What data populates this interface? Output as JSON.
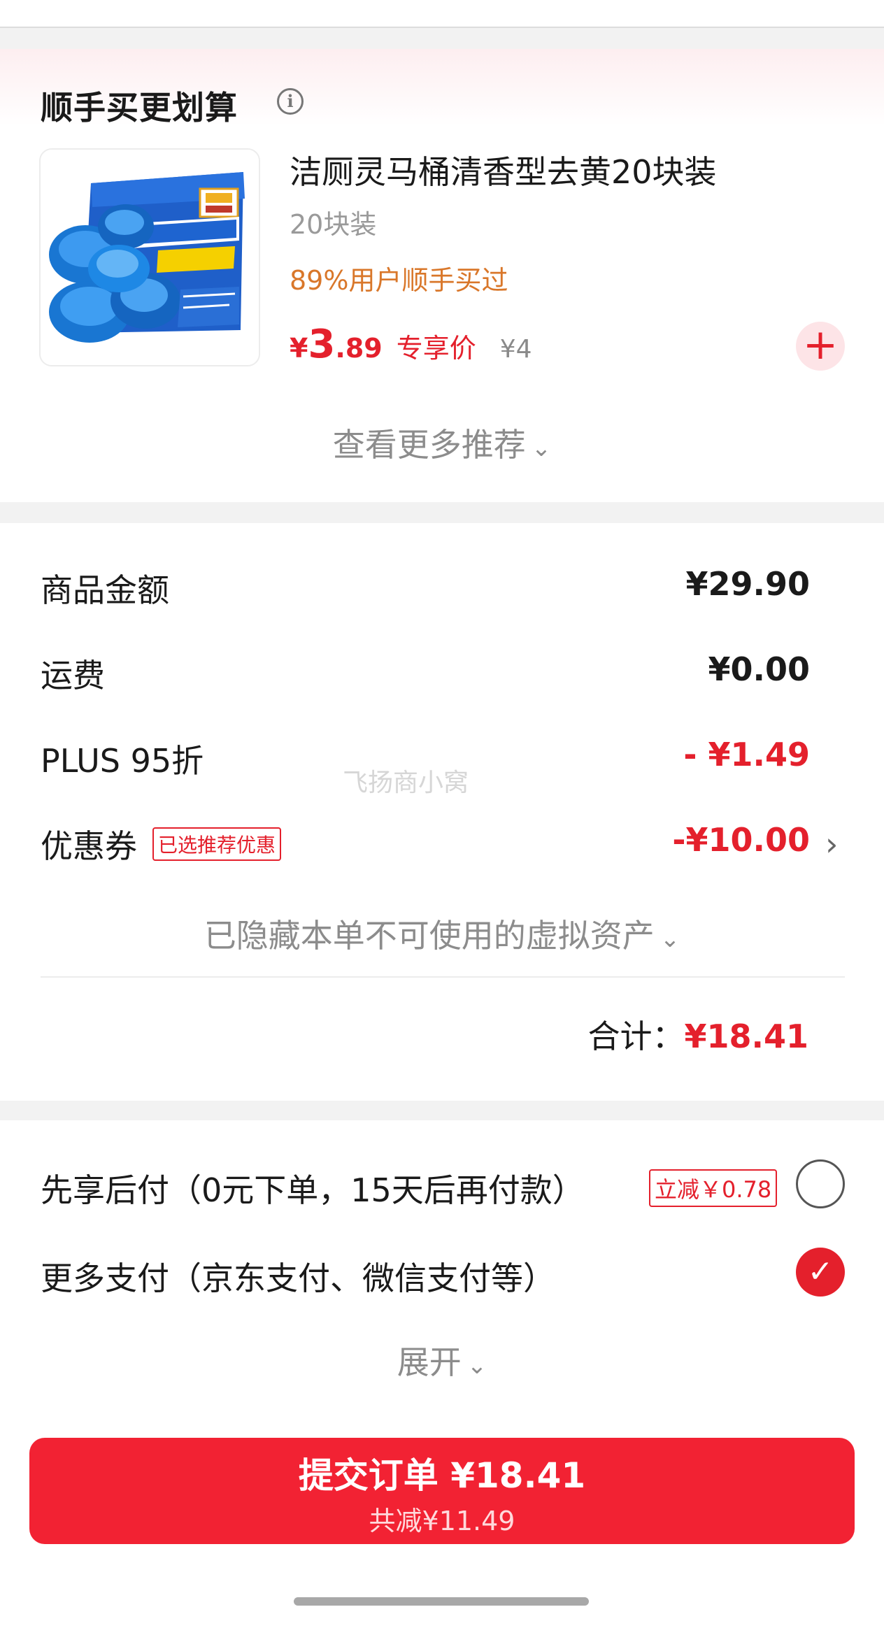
{
  "recommend": {
    "title": "顺手买更划算",
    "info_icon": "info-icon",
    "product": {
      "name": "洁厕灵马桶清香型去黄20块装",
      "spec": "20块装",
      "social": "89%用户顺手买过",
      "price_symbol": "¥",
      "price_int": "3",
      "price_dec": ".89",
      "price_tag": "专享价",
      "original_price": "¥4",
      "add_icon": "plus-icon"
    },
    "more_label": "查看更多推荐",
    "chevron": "⌄"
  },
  "summary": {
    "rows": [
      {
        "label": "商品金额",
        "value": "¥29.90"
      },
      {
        "label": "运费",
        "value": "¥0.00"
      },
      {
        "label": "PLUS 95折",
        "value": "- ¥1.49"
      },
      {
        "label": "优惠券",
        "badge": "已选推荐优惠",
        "value": "-¥10.00"
      }
    ],
    "hidden_assets": "已隐藏本单不可使用的虚拟资产",
    "total_label": "合计：",
    "total_value": "¥18.41",
    "watermark": "飞扬商小窝"
  },
  "payment": {
    "options": [
      {
        "label": "先享后付（0元下单，15天后再付款）",
        "badge": "立减￥0.78",
        "selected": false
      },
      {
        "label": "更多支付（京东支付、微信支付等）",
        "selected": true
      }
    ],
    "expand_label": "展开"
  },
  "submit": {
    "label": "提交订单 ¥18.41",
    "sub": "共减¥11.49"
  },
  "colors": {
    "accent_red": "#e4202c",
    "button_red": "#f22233",
    "social_orange": "#d9772a"
  }
}
